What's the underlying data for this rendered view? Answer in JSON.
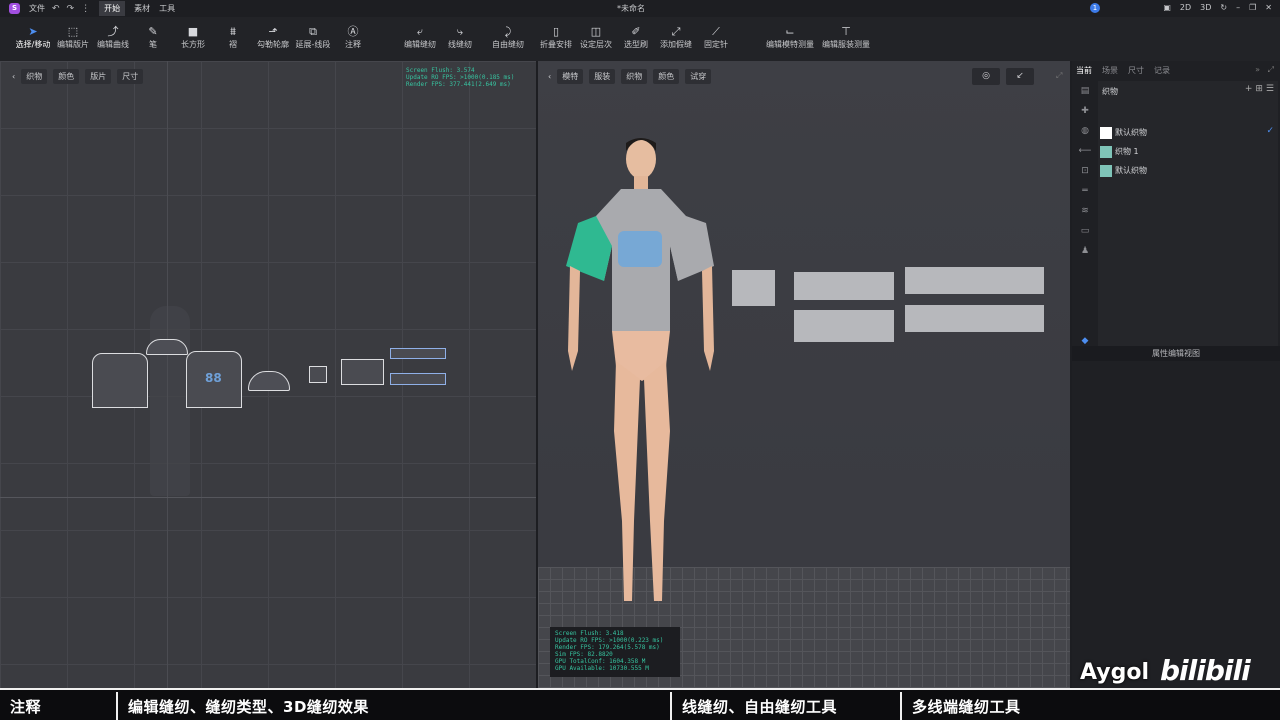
{
  "titlebar": {
    "app_icon": "S",
    "file_menu": "文件",
    "tabs": [
      "开始",
      "素材",
      "工具"
    ],
    "doc_title": "*未命名",
    "notification_count": "1",
    "mode_2d": "2D",
    "mode_3d": "3D"
  },
  "toolbar": {
    "tools": [
      {
        "label": "选择/移动",
        "icon": "cursor-icon",
        "selected": true
      },
      {
        "label": "编辑版片",
        "icon": "edit-pattern-icon"
      },
      {
        "label": "编辑曲线",
        "icon": "curve-icon"
      },
      {
        "label": "笔",
        "icon": "pen-icon"
      },
      {
        "label": "长方形",
        "icon": "rectangle-icon"
      },
      {
        "label": "褶",
        "icon": "pleat-icon"
      },
      {
        "label": "勾勒轮廓",
        "icon": "trace-icon"
      },
      {
        "label": "延展-线段",
        "icon": "extend-icon"
      },
      {
        "label": "注释",
        "icon": "annotation-icon"
      },
      {
        "label": "编辑缝纫",
        "icon": "edit-sewing-icon"
      },
      {
        "label": "线缝纫",
        "icon": "segment-sewing-icon"
      },
      {
        "label": "自由缝纫",
        "icon": "free-sewing-icon"
      },
      {
        "label": "折叠安排",
        "icon": "fold-icon"
      },
      {
        "label": "设定层次",
        "icon": "layer-icon"
      },
      {
        "label": "选型刷",
        "icon": "brush-icon"
      },
      {
        "label": "添加假缝",
        "icon": "tack-icon"
      },
      {
        "label": "固定针",
        "icon": "pin-icon"
      },
      {
        "label": "编辑模特测量",
        "icon": "avatar-measure-icon"
      },
      {
        "label": "编辑服装测量",
        "icon": "garment-measure-icon"
      }
    ]
  },
  "panel2d": {
    "buttons": [
      "织物",
      "颜色",
      "版片",
      "尺寸"
    ],
    "fps": [
      "Screen Flush: 3.574",
      "Update RO FPS: >1000(0.185 ms)",
      "Render FPS: 377.441(2.649 ms)"
    ]
  },
  "panel3d": {
    "buttons": [
      "模特",
      "服装",
      "织物",
      "颜色",
      "试穿"
    ],
    "fps": [
      "Screen Flush: 3.418",
      "Update RO FPS: >1000(0.223 ms)",
      "Render FPS: 179.264(5.578 ms)",
      "Sim FPS: 82.8820",
      "GPU TotalConf: 1604.358 M",
      "GPU Available: 10730.555 M"
    ]
  },
  "rpanel": {
    "tabs": [
      "当前",
      "场景",
      "尺寸",
      "记录"
    ],
    "category": "织物",
    "fabrics": [
      {
        "name": "默认织物",
        "color": "#ffffff",
        "checked": true
      },
      {
        "name": "织物 1",
        "color": "#7fc4b8"
      },
      {
        "name": "默认织物",
        "color": "#7fc4b8"
      }
    ],
    "property_title": "属性编辑视图"
  },
  "captions": [
    "注释",
    "编辑缝纫、缝纫类型、3D缝纫效果",
    "线缝纫、自由缝纫工具",
    "多线端缝纫工具"
  ],
  "watermark": {
    "author": "Aygol",
    "site": "bilibili"
  },
  "colors": {
    "accent": "#4d8ef0",
    "fps_text": "#37c4a0",
    "sleeve": "#2fb991"
  }
}
